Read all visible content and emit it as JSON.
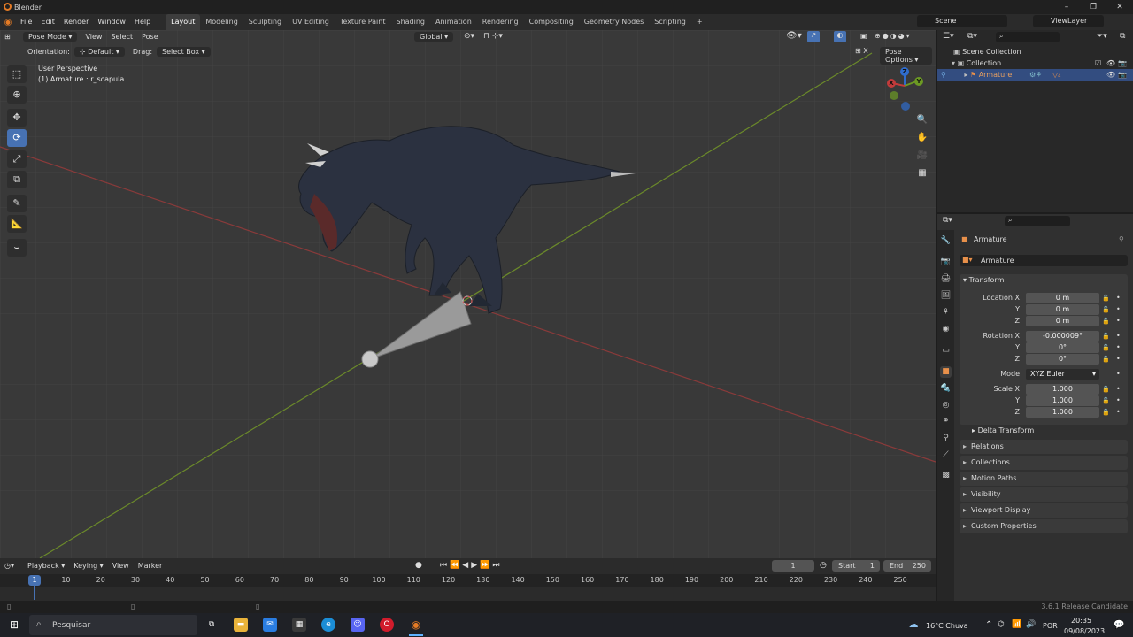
{
  "window": {
    "title": "Blender",
    "minimize": "–",
    "restore": "❐",
    "close": "✕"
  },
  "menu": [
    "File",
    "Edit",
    "Render",
    "Window",
    "Help"
  ],
  "workspaces": [
    "Layout",
    "Modeling",
    "Sculpting",
    "UV Editing",
    "Texture Paint",
    "Shading",
    "Animation",
    "Rendering",
    "Compositing",
    "Geometry Nodes",
    "Scripting"
  ],
  "add_workspace": "+",
  "scene": {
    "label": "Scene",
    "view_layer": "ViewLayer"
  },
  "viewport": {
    "mode": "Pose Mode",
    "menus": [
      "View",
      "Select",
      "Pose"
    ],
    "transform_orientation": "Global",
    "orientation_label": "Orientation:",
    "orientation_value": "Default",
    "drag_label": "Drag:",
    "drag_value": "Select Box",
    "pose_options": "Pose Options",
    "info_line1": "User Perspective",
    "info_line2": "(1) Armature : r_scapula",
    "gizmo": {
      "x": "X",
      "y": "Y",
      "z": "Z"
    }
  },
  "outliner": {
    "scene_collection": "Scene Collection",
    "collection": "Collection",
    "armature": "Armature"
  },
  "properties": {
    "object_name": "Armature",
    "data_name": "Armature",
    "transform_title": "Transform",
    "location_label": "Location X",
    "location": [
      "0 m",
      "0 m",
      "0 m"
    ],
    "rotation_label": "Rotation X",
    "rotation": [
      "-0.000009°",
      "0°",
      "0°"
    ],
    "mode_label": "Mode",
    "mode_value": "XYZ Euler",
    "scale_label": "Scale X",
    "scale": [
      "1.000",
      "1.000",
      "1.000"
    ],
    "axis_y": "Y",
    "axis_z": "Z",
    "delta": "Delta Transform",
    "panels": [
      "Relations",
      "Collections",
      "Motion Paths",
      "Visibility",
      "Viewport Display",
      "Custom Properties"
    ]
  },
  "timeline": {
    "menus": [
      "Playback",
      "Keying",
      "View",
      "Marker"
    ],
    "current_frame": "1",
    "start_label": "Start",
    "start": "1",
    "end_label": "End",
    "end": "250",
    "frames": [
      "1",
      "10",
      "20",
      "30",
      "40",
      "50",
      "60",
      "70",
      "80",
      "90",
      "100",
      "110",
      "120",
      "130",
      "140",
      "150",
      "160",
      "170",
      "180",
      "190",
      "200",
      "210",
      "220",
      "230",
      "240",
      "250"
    ]
  },
  "status": {
    "version": "3.6.1 Release Candidate"
  },
  "taskbar": {
    "search_placeholder": "Pesquisar",
    "weather": "16°C  Chuva",
    "language": "POR",
    "time": "20:35",
    "date": "09/08/2023"
  }
}
